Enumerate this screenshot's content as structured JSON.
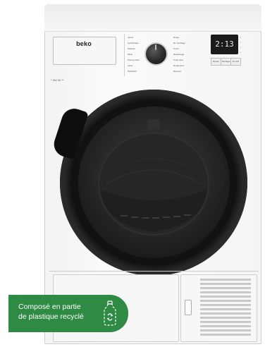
{
  "product": {
    "brand": "beko",
    "spec_label": "* Hb/ 2k **"
  },
  "control_panel": {
    "programs_left": [
      "Jeans",
      "Synthétique",
      "Délicats",
      "Mixte",
      "Prêt-à-porter",
      "Laine",
      "Rafraîchir"
    ],
    "programs_right": [
      "Draps",
      "Ex. Séchage",
      "Coton",
      "Repassage",
      "Coton Eco",
      "Doudounes",
      "Express"
    ],
    "display_value": "2:13",
    "buttons": [
      "Départ",
      "Séchage",
      "Fin diff."
    ]
  },
  "badge": {
    "line1": "Composé en partie",
    "line2": "de plastique recyclé",
    "icon": "recycled-bottle-icon",
    "color": "#2f8a44"
  }
}
